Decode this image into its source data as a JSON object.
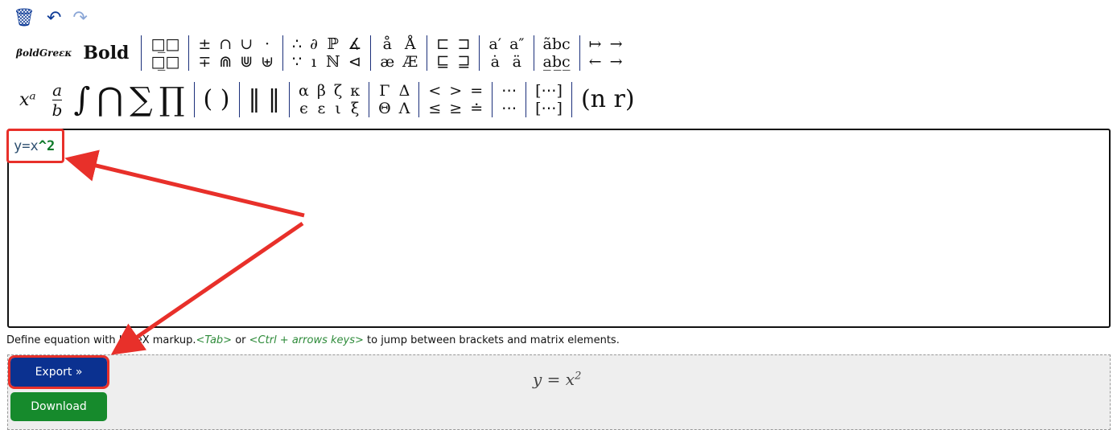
{
  "toolbar": {
    "icons": [
      "trash-icon",
      "undo-icon",
      "redo-icon"
    ]
  },
  "row1": {
    "bold_greek": "βoldGreεκ",
    "bold": "Bold",
    "groups": [
      [
        "□̲□",
        "□̲□"
      ],
      [
        "±",
        "∓",
        "∩",
        "⋒",
        "∪",
        "⋓",
        "·",
        "⊎"
      ],
      [
        "∴",
        "∵",
        "∂",
        "ı",
        "ℙ",
        "ℕ",
        "∡",
        "⊲"
      ],
      [
        "å",
        "æ",
        "Å",
        "Æ"
      ],
      [
        "⊏",
        "⊑",
        "⊐",
        "⊒"
      ],
      [
        "a′",
        "ȧ",
        "a″",
        "ä"
      ],
      [
        "ãbc",
        "a̲b̲c̲"
      ],
      [
        "↦",
        "←",
        "→",
        "→"
      ]
    ]
  },
  "row2": {
    "sup": "xᵃ",
    "frac_num": "a",
    "frac_den": "b",
    "int": "∫",
    "cap": "⋂",
    "sum": "∑",
    "prod": "∏",
    "groups": [
      [
        "( )"
      ],
      [
        "‖ ‖"
      ],
      [
        "α",
        "ϵ",
        "β",
        "ε",
        "ζ",
        "ι",
        "κ",
        "ξ"
      ],
      [
        "Γ",
        "Θ",
        "Δ",
        "Λ"
      ],
      [
        "<",
        "≤",
        ">",
        "≥",
        "=",
        "≐"
      ],
      [
        "⋯",
        "⋯"
      ],
      [
        "[⋯]",
        "[⋯]"
      ],
      [
        "(n r)"
      ]
    ]
  },
  "editor": {
    "code_plain": "y=x",
    "code_caret": "^2"
  },
  "help": {
    "text1": "Define equation with LaTeX markup.",
    "tab": "<Tab>",
    "or": " or ",
    "keys": "<Ctrl + arrows keys>",
    "text2": " to jump between brackets and matrix elements."
  },
  "preview": {
    "export": "Export »",
    "download": "Download",
    "equation": "y = x",
    "exponent": "2"
  },
  "colors": {
    "accent": "#0b3190",
    "download": "#168a2c",
    "highlight": "#e8302a"
  }
}
